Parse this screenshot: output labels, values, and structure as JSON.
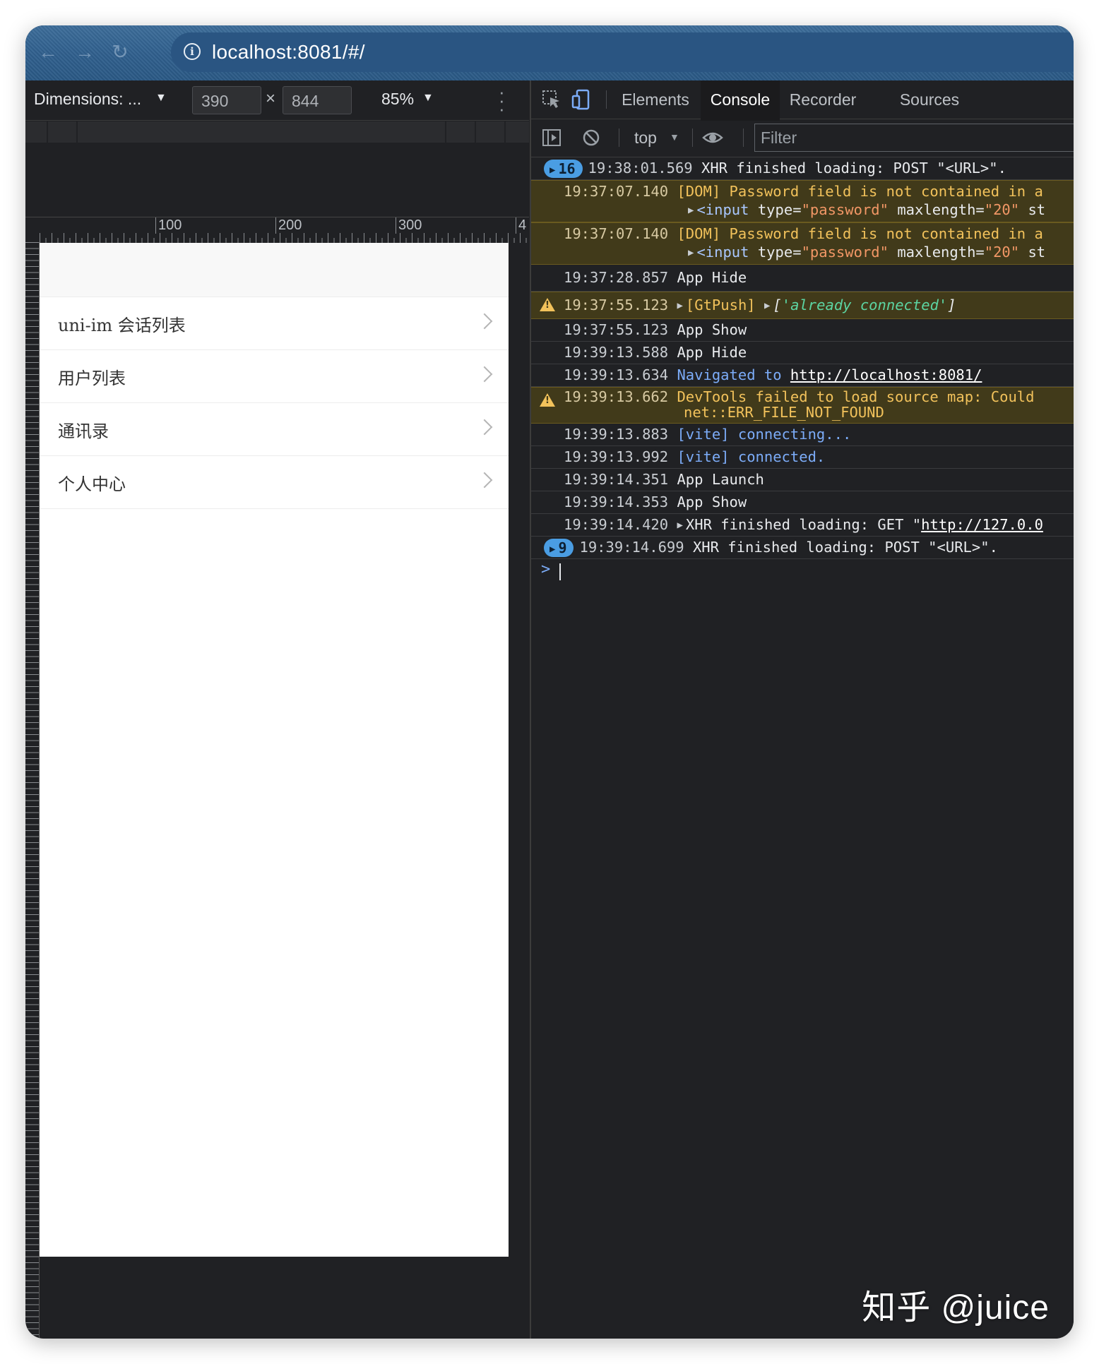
{
  "browser": {
    "url": "localhost:8081/#/"
  },
  "device_toolbar": {
    "dimensions_label": "Dimensions: ...",
    "width": "390",
    "height": "844",
    "times": "×",
    "zoom": "85%"
  },
  "ruler": {
    "labels": [
      "100",
      "200",
      "300",
      "4"
    ]
  },
  "phone": {
    "rows": [
      {
        "label": "uni-im 会话列表"
      },
      {
        "label": "用户列表"
      },
      {
        "label": "通讯录"
      },
      {
        "label": "个人中心"
      }
    ]
  },
  "devtools": {
    "tabs": {
      "elements": "Elements",
      "console": "Console",
      "recorder": "Recorder",
      "sources": "Sources"
    },
    "context": "top",
    "filter_placeholder": "Filter",
    "messages": {
      "m1": {
        "badge": "16",
        "ts": "19:38:01.569",
        "text": "XHR finished loading: POST \"<URL>\"."
      },
      "m2": {
        "ts": "19:37:07.140",
        "text": "[DOM] Password field is not contained in a",
        "sub_tag": "<input",
        "sub_attr1": "type=",
        "sub_val1": "\"password\"",
        "sub_attr2": "maxlength=",
        "sub_val2": "\"20\"",
        "sub_rest": "st"
      },
      "m3": {
        "ts": "19:37:07.140",
        "text": "[DOM] Password field is not contained in a",
        "sub_tag": "<input",
        "sub_attr1": "type=",
        "sub_val1": "\"password\"",
        "sub_attr2": "maxlength=",
        "sub_val2": "\"20\"",
        "sub_rest": "st"
      },
      "m4": {
        "ts": "19:37:28.857",
        "text": "App Hide"
      },
      "m5": {
        "ts": "19:37:55.123",
        "tag": "[GtPush]",
        "arr_open": "[",
        "arr_val": "'already connected'",
        "arr_close": "]"
      },
      "m6": {
        "ts": "19:37:55.123",
        "text": "App Show"
      },
      "m7": {
        "ts": "19:39:13.588",
        "text": "App Hide"
      },
      "m8": {
        "ts": "19:39:13.634",
        "text": "Navigated to",
        "link": "http://localhost:8081/"
      },
      "m9": {
        "ts": "19:39:13.662",
        "text": "DevTools failed to load source map: Could",
        "text2": "net::ERR_FILE_NOT_FOUND"
      },
      "m10": {
        "ts": "19:39:13.883",
        "text": "[vite] connecting..."
      },
      "m11": {
        "ts": "19:39:13.992",
        "text": "[vite] connected."
      },
      "m12": {
        "ts": "19:39:14.351",
        "text": "App Launch"
      },
      "m13": {
        "ts": "19:39:14.353",
        "text": "App Show"
      },
      "m14": {
        "ts": "19:39:14.420",
        "text": "XHR finished loading: GET \"",
        "link": "http://127.0.0"
      },
      "m15": {
        "badge": "9",
        "ts": "19:39:14.699",
        "text": "XHR finished loading: POST \"<URL>\"."
      }
    },
    "prompt": ">"
  },
  "watermark": "知乎 @juice",
  "colors": {
    "warning_bg": "#413a1a",
    "warning_text": "#f2c25b",
    "badge": "#4a9de3",
    "accent_blue": "#7cacf8"
  }
}
